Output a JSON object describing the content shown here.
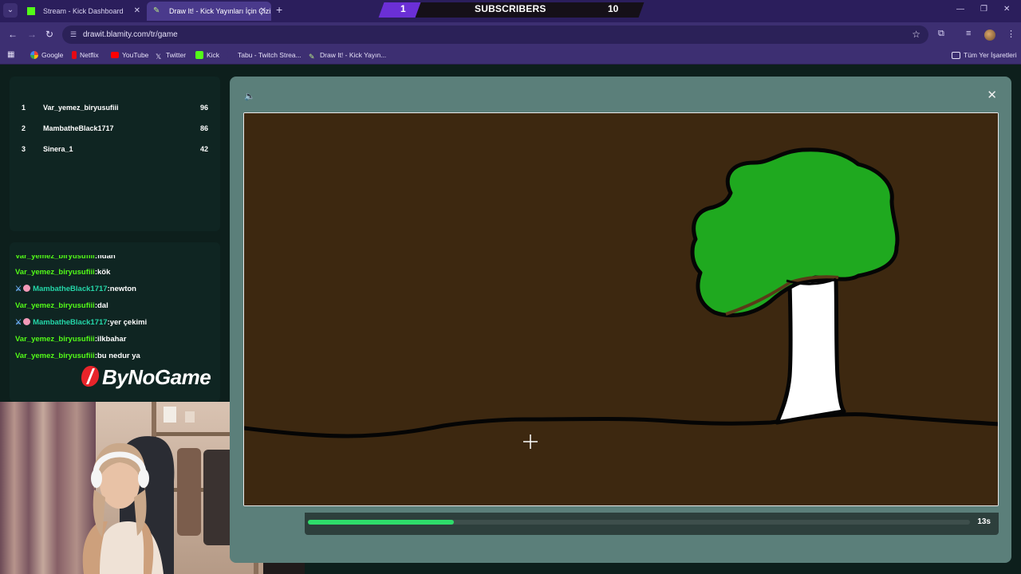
{
  "browser": {
    "tabs": [
      {
        "title": "Stream - Kick Dashboard",
        "active": false
      },
      {
        "title": "Draw It! - Kick Yayınları İçin Çizi",
        "active": true
      }
    ],
    "url": "drawit.blamity.com/tr/game",
    "bookmarks": [
      {
        "label": "Google",
        "icon": "google-icon"
      },
      {
        "label": "Netflix",
        "icon": "netflix-icon"
      },
      {
        "label": "YouTube",
        "icon": "youtube-icon"
      },
      {
        "label": "Twitter",
        "icon": "x-icon"
      },
      {
        "label": "Kick",
        "icon": "kick-icon"
      },
      {
        "label": "Tabu - Twitch Strea...",
        "icon": "tabu-icon"
      },
      {
        "label": "Draw It! - Kick Yayın...",
        "icon": "drawit-icon"
      }
    ],
    "all_bookmarks_label": "Tüm Yer İşaretleri"
  },
  "subscriber_overlay": {
    "left_value": "1",
    "label": "SUBSCRIBERS",
    "right_value": "10"
  },
  "leaderboard": [
    {
      "rank": "1",
      "name": "Var_yemez_biryusufiii",
      "score": "96"
    },
    {
      "rank": "2",
      "name": "MambatheBlack1717",
      "score": "86"
    },
    {
      "rank": "3",
      "name": "Sinera_1",
      "score": "42"
    }
  ],
  "chat": [
    {
      "user": "Var_yemez_biryusufiii",
      "message": "fidan",
      "badges": false
    },
    {
      "user": "Var_yemez_biryusufiii",
      "message": "kök",
      "badges": false
    },
    {
      "user": "MambatheBlack1717",
      "message": "newton",
      "badges": true
    },
    {
      "user": "Var_yemez_biryusufiii",
      "message": "dal",
      "badges": false
    },
    {
      "user": "MambatheBlack1717",
      "message": "yer çekimi",
      "badges": true
    },
    {
      "user": "Var_yemez_biryusufiii",
      "message": "ilkbahar",
      "badges": false
    },
    {
      "user": "Var_yemez_biryusufiii",
      "message": "bu nedur ya",
      "badges": false
    }
  ],
  "sponsor": {
    "name": "ByNoGame"
  },
  "game": {
    "timer": "13s",
    "progress": 0.22
  },
  "colors": {
    "kick_green": "#53fc18",
    "canvas_bg": "#3d2810",
    "tree_crown": "#1fa91f",
    "trunk": "#ffffff",
    "progress": "#2edc6a"
  }
}
